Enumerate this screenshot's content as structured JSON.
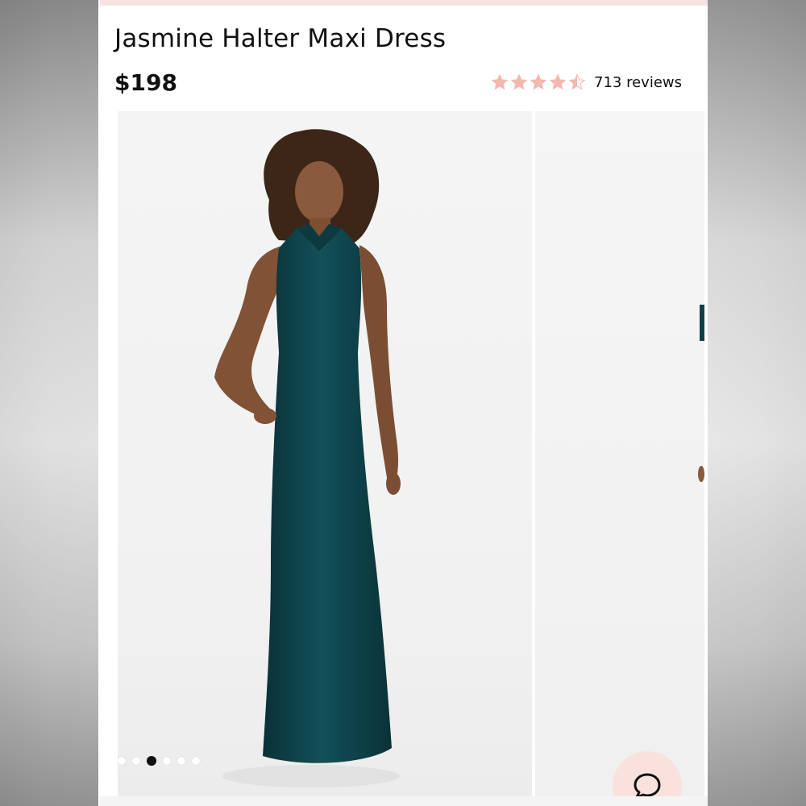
{
  "product": {
    "title": "Jasmine Halter Maxi Dress",
    "price": "$198",
    "rating": {
      "value": 4.5,
      "max": 5,
      "reviews_label": "713 reviews",
      "star_color": "#f4b8b1"
    }
  },
  "gallery": {
    "slide_count": 6,
    "active_index": 2,
    "dress_color": "#0e4047"
  },
  "icons": {
    "rating": "star-icon",
    "chat": "chat-bubble-icon"
  },
  "colors": {
    "accent_pink": "#f9e2dd",
    "text": "#111111"
  }
}
